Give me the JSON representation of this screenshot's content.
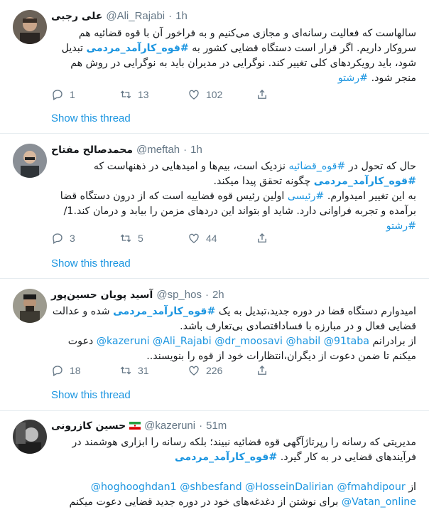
{
  "tweets": [
    {
      "name": "علی رجبی",
      "handle": "@Ali_Rajabi",
      "dot": "·",
      "time": "1h",
      "lines": [
        [
          "سالهاست که فعالیت رسانه‌ای و مجازی می‌کنیم و به فراخور آن با قوه قضائیه هم"
        ],
        [
          "سروکار داریم. اگر قرار است دستگاه قضایی کشور به ",
          "#قوه_کارآمد_مردمی",
          " تبدیل"
        ],
        [
          "شود، باید رویکردهای کلی تغییر کند. نوگرایی در مدیران باید به نوگرایی در روش هم"
        ],
        [
          "منجر شود. ",
          "#رشتو"
        ]
      ],
      "reply": "1",
      "retweet": "13",
      "like": "102",
      "show_thread": "Show this thread"
    },
    {
      "name": "محمدصالح مفتاح",
      "handle": "@meftah",
      "dot": "·",
      "time": "1h",
      "lines": [
        [
          "حال که تحول در ",
          "#قوه_قضائیه",
          " نزدیک است، بیم‌ها و امیدهایی در ذهنهاست که"
        ],
        [
          "#قوه_کارآمد_مردمی",
          " چگونه تحقق پیدا میکند."
        ],
        [
          "به این تغییر امیدوارم. ",
          "#رئیسی",
          " اولین رئیس قوه قضاییه است که از درون دستگاه قضا"
        ],
        [
          "برآمده و تجربه فراوانی دارد. شاید او بتواند این دردهای مزمن را بیابد و درمان کند.1/"
        ],
        [
          "#رشتو"
        ]
      ],
      "reply": "3",
      "retweet": "5",
      "like": "44",
      "show_thread": "Show this thread"
    },
    {
      "name": "آسید پویان حسین‌پور",
      "handle": "@sp_hos",
      "dot": "·",
      "time": "2h",
      "lines": [
        [
          "امیدوارم دستگاه قضا در دوره جدید،تبدیل به یک ",
          "#قوه_کارآمد_مردمی",
          " شده و عدالت"
        ],
        [
          "قضایی فعال و در مبارزه با فساداقتصادی بی‌تعارف باشد."
        ],
        [
          "از برادرانم ",
          "@kazeruni @Ali_Rajabi @dr_moosavi @habil @91taba",
          " دعوت"
        ],
        [
          "میکنم تا ضمن دعوت از دیگران،انتظارات خود از قوه را بنویسند.."
        ]
      ],
      "reply": "18",
      "retweet": "31",
      "like": "226",
      "show_thread": "Show this thread"
    },
    {
      "name": "حسین کازرونی",
      "handle": "@kazeruni",
      "dot": "·",
      "time": "51m",
      "lines": [
        [
          "مدیریتی که رسانه را رپرتاژآگهی قوه قضائیه نبیند؛ بلکه رسانه را ابزاری هوشمند در"
        ],
        [
          "فرآیندهای قضایی در به کار گیرد. ",
          "#قوه_کارآمد_مردمی"
        ],
        [
          ""
        ],
        [
          "از ",
          "@hoghooghdan1 @shbesfand @HosseinDalirian @fmahdipour"
        ],
        [
          "@Vatan_online",
          " برای نوشتن از دغدغه‌های خود در دوره جدید قضایی دعوت میکنم"
        ]
      ]
    }
  ]
}
